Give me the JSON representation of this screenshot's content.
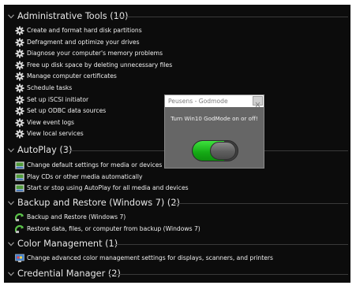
{
  "groups": {
    "admin": {
      "title": "Administrative Tools (10)",
      "items": [
        "Create and format hard disk partitions",
        "Defragment and optimize your drives",
        "Diagnose your computer's memory problems",
        "Free up disk space by deleting unnecessary files",
        "Manage computer certificates",
        "Schedule tasks",
        "Set up iSCSI initiator",
        "Set up ODBC data sources",
        "View event logs",
        "View local services"
      ]
    },
    "autoplay": {
      "title": "AutoPlay (3)",
      "items": [
        "Change default settings for media or devices",
        "Play CDs or other media automatically",
        "Start or stop using AutoPlay for all media and devices"
      ]
    },
    "backup": {
      "title": "Backup and Restore (Windows 7) (2)",
      "items": [
        "Backup and Restore (Windows 7)",
        "Restore data, files, or computer from backup (Windows 7)"
      ]
    },
    "color": {
      "title": "Color Management (1)",
      "items": [
        "Change advanced color management settings for displays, scanners, and printers"
      ]
    },
    "credential": {
      "title": "Credential Manager (2)"
    }
  },
  "icons": {
    "admin": "gear-icon",
    "autoplay": "autoplay-icon",
    "backup": "backup-restore-icon",
    "color": "color-management-icon"
  },
  "dialog": {
    "title": "Peusens - Godmode",
    "prompt": "Turn Win10 GodMode on or off!",
    "toggle_level": 0.45
  },
  "colors": {
    "background": "#0c0c0c",
    "text": "#f0f0f0",
    "toggle_on": "#14a814",
    "dialog_bg": "#666666"
  }
}
